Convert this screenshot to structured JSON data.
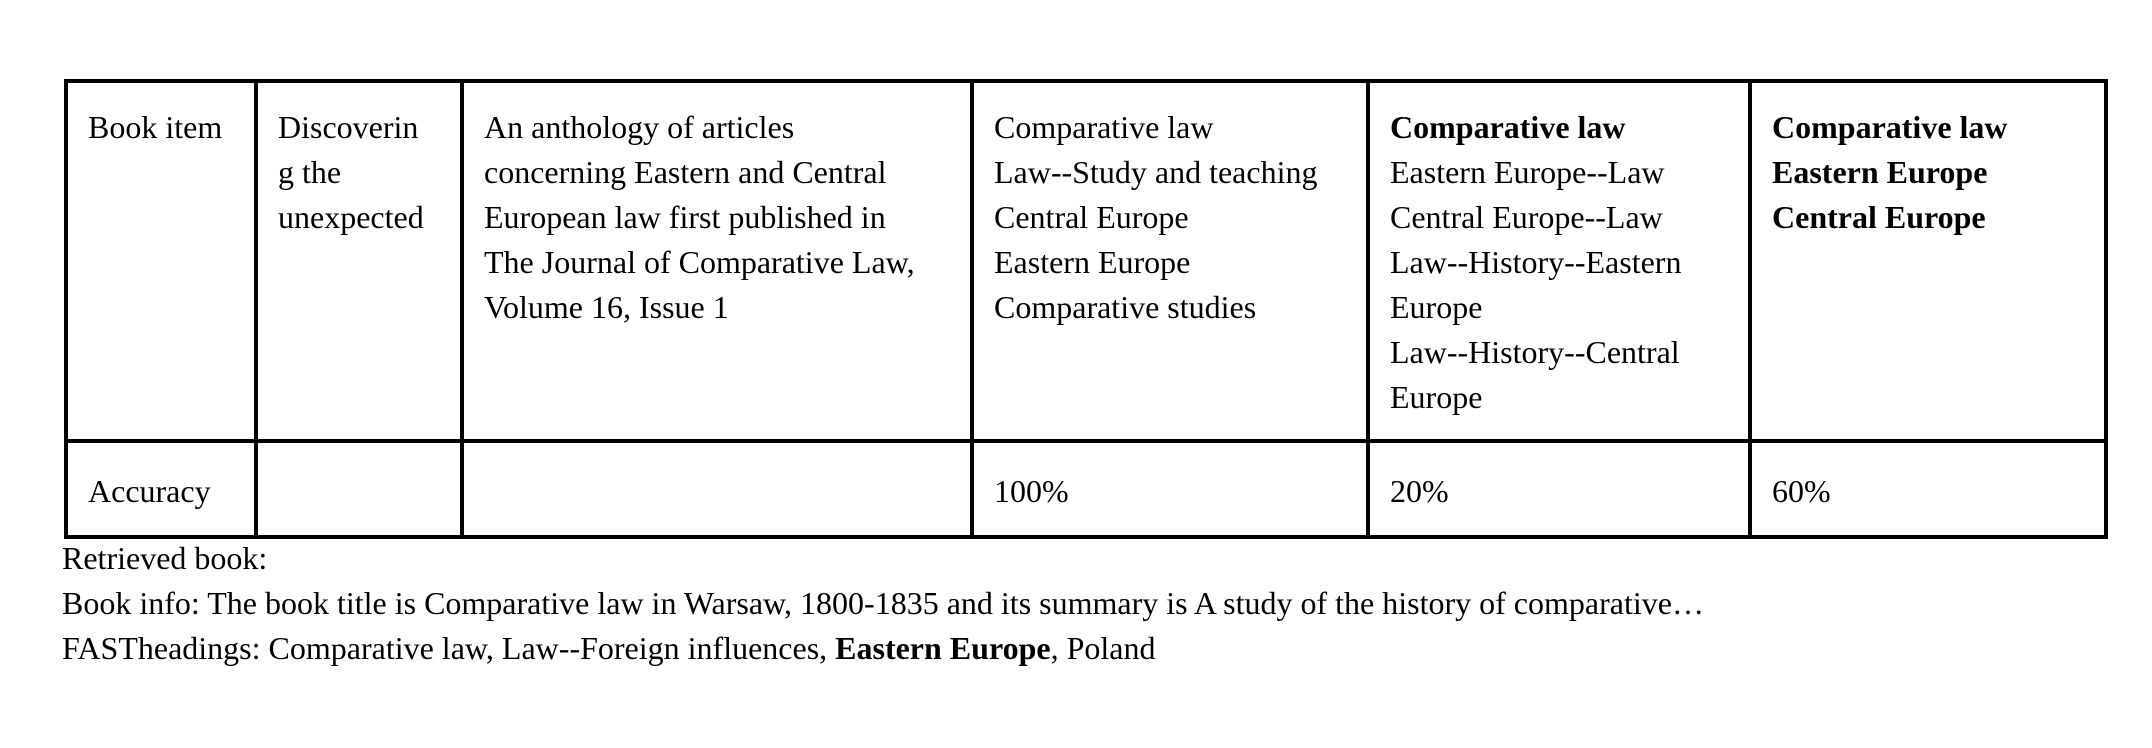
{
  "table": {
    "rows": [
      {
        "label": "Book item",
        "title_lines": [
          "Discoverin",
          "g the",
          "unexpected"
        ],
        "summary_lines": [
          "An anthology of articles",
          "concerning Eastern and Central",
          "European law first published in",
          "The Journal of Comparative Law,",
          "Volume 16, Issue 1"
        ],
        "col4_lines": [
          "Comparative law",
          "Law--Study and teaching",
          "Central Europe",
          "Eastern Europe",
          "Comparative studies"
        ],
        "col5_bold_line": "Comparative law",
        "col5_lines": [
          "Eastern Europe--Law",
          "Central Europe--Law",
          "Law--History--Eastern",
          "Europe",
          "Law--History--Central",
          "Europe"
        ],
        "col6_bold_lines": [
          "Comparative law",
          "Eastern Europe",
          "Central Europe"
        ]
      },
      {
        "label": "Accuracy",
        "col2": "",
        "col3": "",
        "col4": "100%",
        "col5": "20%",
        "col6": "60%"
      }
    ]
  },
  "notes": {
    "retrieved_label": "Retrieved book:",
    "book_info": "Book info: The book title is Comparative law in Warsaw, 1800-1835 and its summary is A study of the history of comparative…",
    "fast_prefix": "FASTheadings: Comparative law, Law--Foreign influences, ",
    "fast_bold": "Eastern Europe",
    "fast_suffix": ", Poland"
  }
}
